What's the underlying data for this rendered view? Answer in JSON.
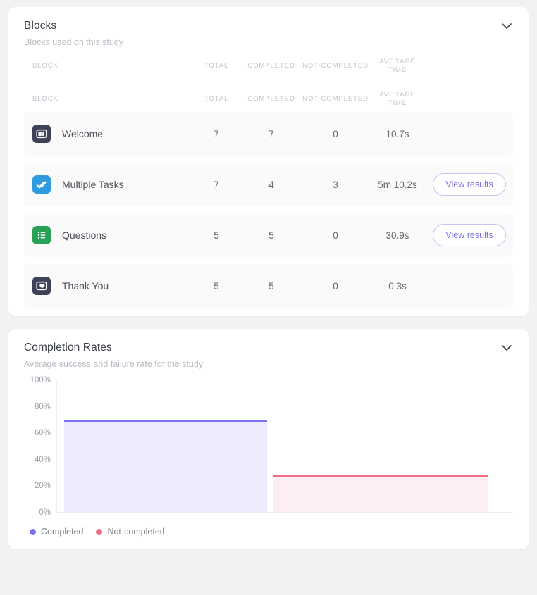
{
  "theme": {
    "page_bg": "#f2f2f4",
    "card_bg": "#ffffff",
    "accent_purple": "#7a72e8",
    "accent_pink": "#ef6e85",
    "row_bg": "#fafafb"
  },
  "blocks_card": {
    "title": "Blocks",
    "subtitle": "Blocks used on this study",
    "collapse_icon": "chevron-down-icon",
    "columns": [
      {
        "key": "block",
        "label": "BLOCK"
      },
      {
        "key": "total",
        "label": "TOTAL"
      },
      {
        "key": "completed",
        "label": "COMPLETED"
      },
      {
        "key": "not_completed",
        "label": "NOT-COMPLETED"
      },
      {
        "key": "average_time",
        "label": "AVERAGE TIME"
      }
    ],
    "rows": [
      {
        "name": "Welcome",
        "icon": "welcome-screen-icon",
        "icon_color": "#3d4257",
        "total": "7",
        "completed": "7",
        "not_completed": "0",
        "average_time": "10.7s",
        "action": ""
      },
      {
        "name": "Multiple Tasks",
        "icon": "double-check-icon",
        "icon_color": "#2e9bdf",
        "total": "7",
        "completed": "4",
        "not_completed": "3",
        "average_time": "5m 10.2s",
        "action": "View results"
      },
      {
        "name": "Questions",
        "icon": "list-icon",
        "icon_color": "#27a155",
        "total": "5",
        "completed": "5",
        "not_completed": "0",
        "average_time": "30.9s",
        "action": "View results"
      },
      {
        "name": "Thank You",
        "icon": "heart-card-icon",
        "icon_color": "#3d4257",
        "total": "5",
        "completed": "5",
        "not_completed": "0",
        "average_time": "0.3s",
        "action": ""
      }
    ]
  },
  "completion_card": {
    "title": "Completion Rates",
    "subtitle": "Average success and failure rate for the study",
    "collapse_icon": "chevron-down-icon"
  },
  "chart_data": {
    "type": "bar",
    "title": "Completion Rates",
    "subtitle": "Average success and failure rate for the study",
    "categories": [
      "Completed",
      "Not-completed"
    ],
    "values": [
      70,
      28
    ],
    "xlabel": "",
    "ylabel": "",
    "ylim": [
      0,
      100
    ],
    "yticks": [
      "0%",
      "20%",
      "40%",
      "60%",
      "80%",
      "100%"
    ],
    "ytick_values": [
      0,
      20,
      40,
      60,
      80,
      100
    ],
    "grid": false,
    "legend_position": "bottom-left",
    "legend": [
      {
        "name": "Completed",
        "color": "#7a72e8",
        "fill": "#ecebfb"
      },
      {
        "name": "Not-completed",
        "color": "#ef6e85",
        "fill": "#fdeef1"
      }
    ]
  }
}
